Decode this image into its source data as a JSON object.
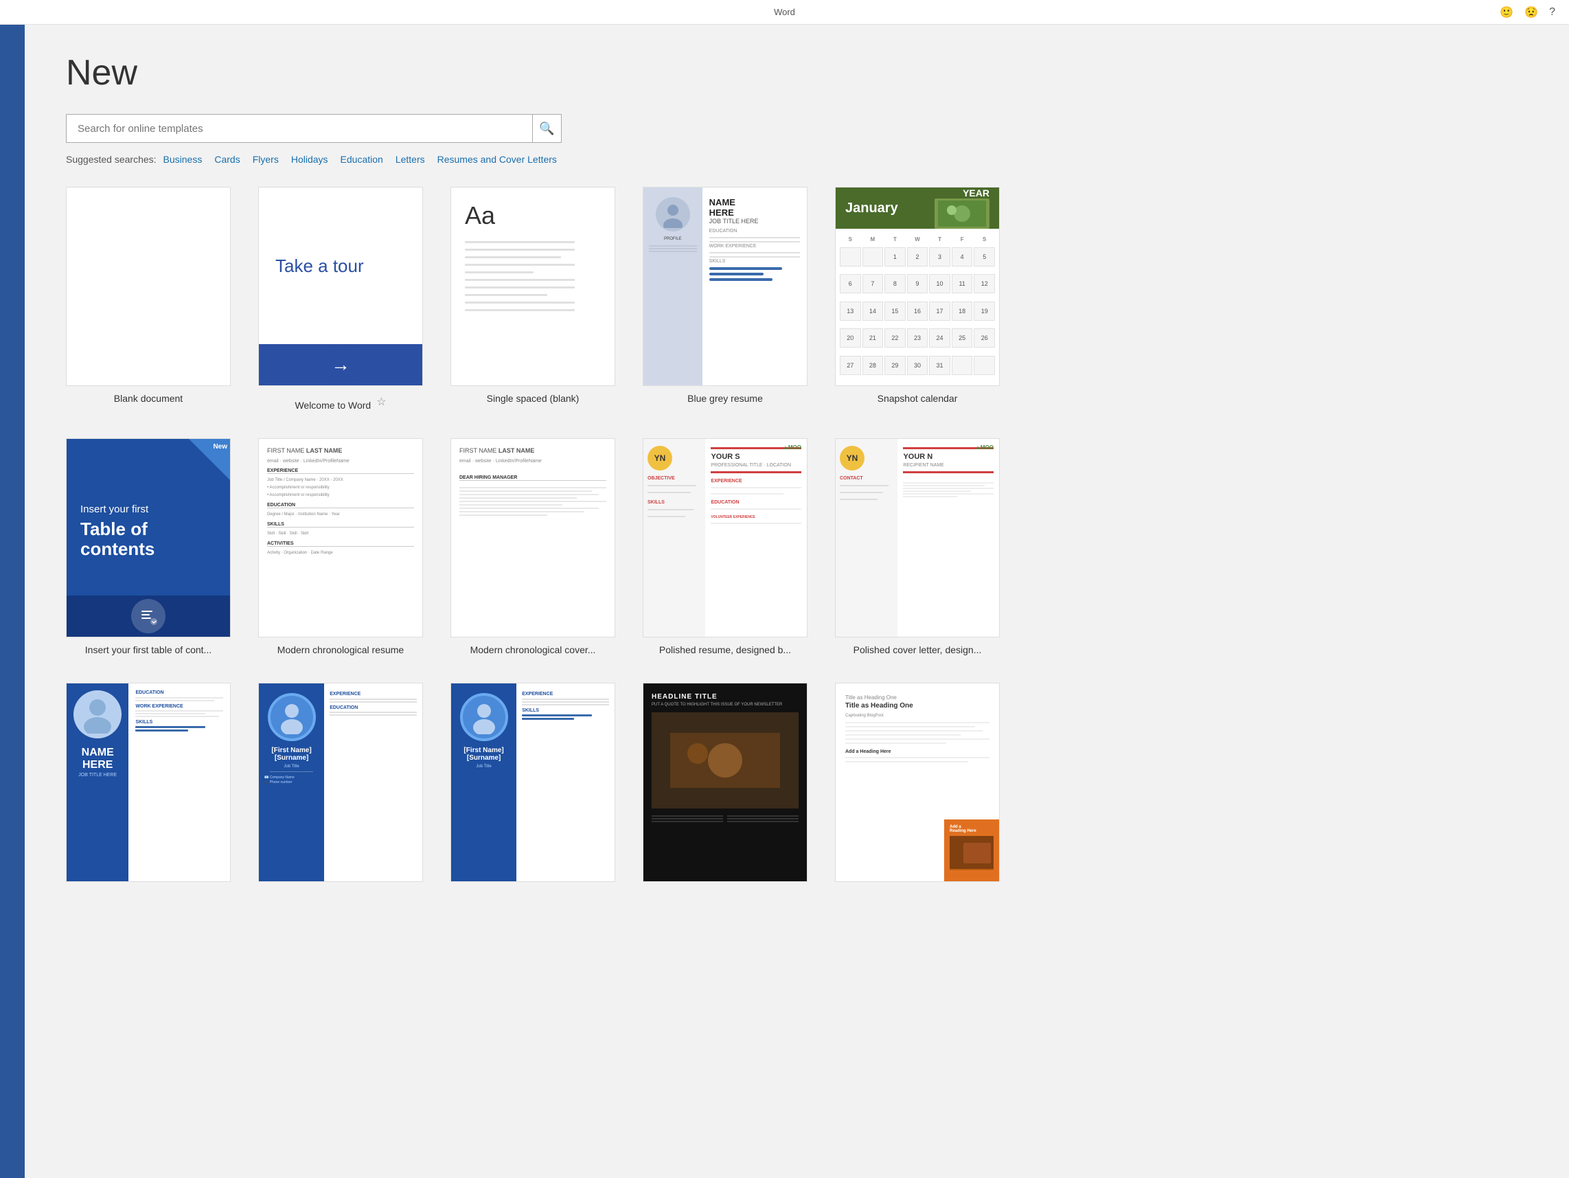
{
  "titleBar": {
    "appName": "Word",
    "icons": {
      "emoji": "🙂",
      "sad": "😟",
      "help": "?"
    }
  },
  "page": {
    "title": "New",
    "searchPlaceholder": "Search for online templates",
    "searchButtonLabel": "🔍",
    "suggestedLabel": "Suggested searches:",
    "suggestedLinks": [
      "Business",
      "Cards",
      "Flyers",
      "Holidays",
      "Education",
      "Letters",
      "Resumes and Cover Letters"
    ]
  },
  "templates": {
    "row1": [
      {
        "id": "blank-doc",
        "label": "Blank document"
      },
      {
        "id": "welcome-word",
        "label": "Welcome to Word"
      },
      {
        "id": "single-spaced",
        "label": "Single spaced (blank)"
      },
      {
        "id": "blue-grey-resume",
        "label": "Blue grey resume"
      },
      {
        "id": "snapshot-calendar",
        "label": "Snapshot calendar"
      }
    ],
    "row2": [
      {
        "id": "toc",
        "label": "Insert your first table of cont..."
      },
      {
        "id": "modern-chrono-resume",
        "label": "Modern chronological resume"
      },
      {
        "id": "modern-chrono-cover",
        "label": "Modern chronological cover..."
      },
      {
        "id": "polished-resume",
        "label": "Polished resume, designed b..."
      },
      {
        "id": "polished-cover",
        "label": "Polished cover letter, design..."
      }
    ],
    "row3": [
      {
        "id": "resume-photo",
        "label": ""
      },
      {
        "id": "blue-resume-1",
        "label": ""
      },
      {
        "id": "blue-resume-2",
        "label": ""
      },
      {
        "id": "newsletter",
        "label": ""
      },
      {
        "id": "blog",
        "label": ""
      }
    ]
  },
  "tour": {
    "text": "Take a tour",
    "arrow": "→"
  },
  "toc": {
    "insertText": "Insert your first",
    "titleText": "Table of\ncontents",
    "newBadge": "New"
  },
  "calendar": {
    "month": "January",
    "year": "YEAR",
    "days": [
      "S",
      "M",
      "T",
      "W",
      "T",
      "F",
      "S"
    ],
    "cells": [
      "",
      "",
      "1",
      "2",
      "3",
      "4",
      "5",
      "6",
      "7",
      "8",
      "9",
      "10",
      "11",
      "12",
      "13",
      "14",
      "15",
      "16",
      "17",
      "18",
      "19",
      "20",
      "21",
      "22",
      "23",
      "24",
      "25",
      "26",
      "27",
      "28",
      "29",
      "30",
      "31",
      "",
      ""
    ]
  },
  "resume": {
    "firstName": "FIRST NAME",
    "lastName": "LAST NAME",
    "contact": "email · website · LinkedIn/ProfileName",
    "sections": [
      "EXPERIENCE",
      "EDUCATION",
      "SKILLS",
      "ACTIVITIES"
    ]
  },
  "polished": {
    "initials": "YN",
    "yourName": "YOUR N",
    "moo": "▲MOO",
    "sections": [
      "OBJECTIVE",
      "EXPERIENCE",
      "SKILLS",
      "EDUCATION",
      "VOLUNTEER EXPERIENCE OR LEADERSHIP"
    ]
  }
}
